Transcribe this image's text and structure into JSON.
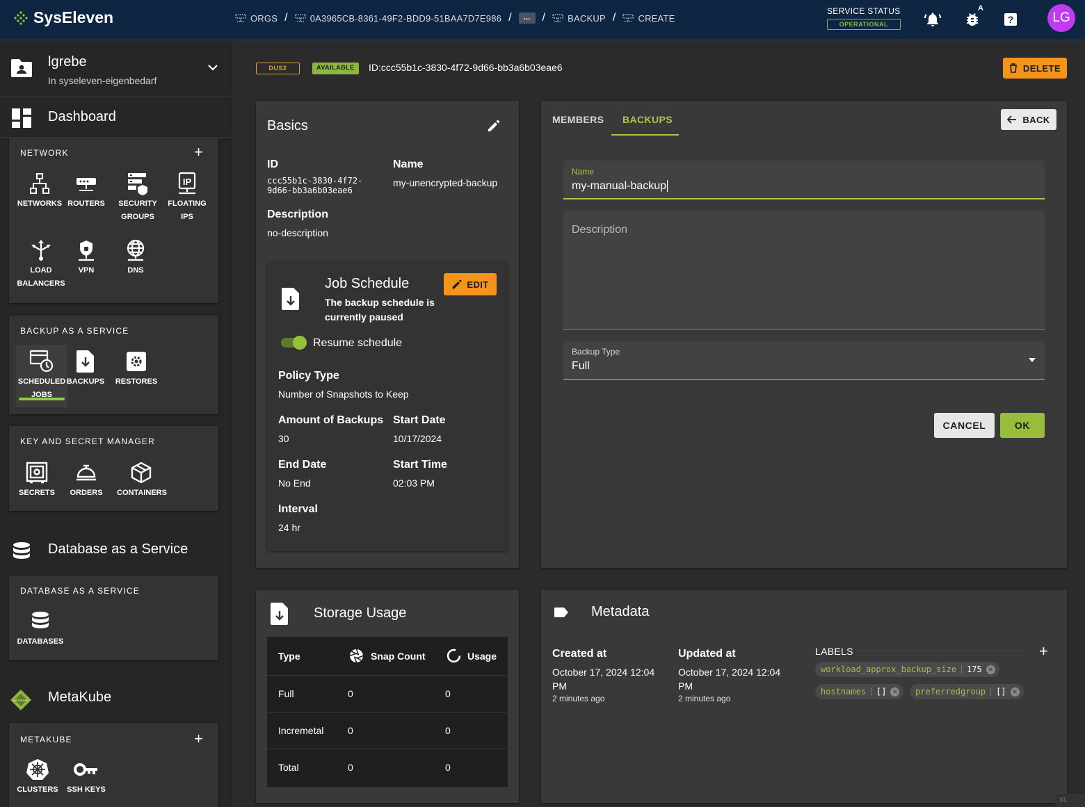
{
  "topbar": {
    "brand": "SysEleven",
    "breadcrumbs": [
      "ORGS",
      "0A3965CB-8361-49F2-BDD9-51BAA7D7E986",
      "...",
      "BACKUP",
      "CREATE"
    ],
    "service_status_label": "SERVICE STATUS",
    "service_status_value": "OPERATIONAL",
    "debug_badge": "A",
    "avatar_initials": "LG"
  },
  "sidebar": {
    "project_name": "lgrebe",
    "project_sub": "In syseleven-eigenbedarf",
    "dashboard_label": "Dashboard",
    "network": {
      "heading": "NETWORK",
      "items": [
        {
          "l1": "NETWORKS",
          "l2": ""
        },
        {
          "l1": "ROUTERS",
          "l2": ""
        },
        {
          "l1": "SECURITY",
          "l2": "GROUPS"
        },
        {
          "l1": "FLOATING",
          "l2": "IPS"
        },
        {
          "l1": "LOAD",
          "l2": "BALANCERS"
        },
        {
          "l1": "VPN",
          "l2": ""
        },
        {
          "l1": "DNS",
          "l2": ""
        }
      ]
    },
    "backup": {
      "heading": "BACKUP AS A SERVICE",
      "items": [
        {
          "l1": "SCHEDULED",
          "l2": "JOBS"
        },
        {
          "l1": "BACKUPS",
          "l2": ""
        },
        {
          "l1": "RESTORES",
          "l2": ""
        }
      ]
    },
    "keys": {
      "heading": "KEY AND SECRET MANAGER",
      "items": [
        {
          "l1": "SECRETS"
        },
        {
          "l1": "ORDERS"
        },
        {
          "l1": "CONTAINERS"
        }
      ]
    },
    "dbaas_title": "Database as a Service",
    "dbaas": {
      "heading": "DATABASE AS A SERVICE",
      "item": "DATABASES"
    },
    "metakube_title": "MetaKube",
    "metakube": {
      "heading": "METAKUBE",
      "items": [
        "CLUSTERS",
        "SSH KEYS"
      ]
    }
  },
  "header": {
    "region": "DUS2",
    "state": "AVAILABLE",
    "id_text": "ID:ccc55b1c-3830-4f72-9d66-bb3a6b03eae6",
    "delete_label": "DELETE"
  },
  "basics": {
    "title": "Basics",
    "id_label": "ID",
    "id_line1": "ccc55b1c-3830-4f72-",
    "id_line2": "9d66-bb3a6b03eae6",
    "name_label": "Name",
    "name_value": "my-unencrypted-backup",
    "desc_label": "Description",
    "desc_value": "no-description"
  },
  "job": {
    "title": "Job Schedule",
    "subtitle_1": "The backup schedule is",
    "subtitle_2": "currently paused",
    "edit_label": "EDIT",
    "toggle_label": "Resume schedule",
    "toggle_on": true,
    "policy_label": "Policy Type",
    "policy_value": "Number of Snapshots to Keep",
    "amount_label": "Amount of Backups",
    "amount_value": "30",
    "start_date_label": "Start Date",
    "start_date_value": "10/17/2024",
    "end_date_label": "End Date",
    "end_date_value": "No End",
    "start_time_label": "Start Time",
    "start_time_value": "02:03 PM",
    "interval_label": "Interval",
    "interval_value": "24 hr"
  },
  "panel": {
    "tabs": [
      "MEMBERS",
      "BACKUPS"
    ],
    "active_tab": "BACKUPS",
    "back_label": "BACK",
    "name_label": "Name",
    "name_value": "my-manual-backup",
    "description_placeholder": "Description",
    "backup_type_label": "Backup Type",
    "backup_type_value": "Full",
    "cancel_label": "CANCEL",
    "ok_label": "OK"
  },
  "storage": {
    "title": "Storage Usage",
    "columns": [
      "Type",
      "Snap Count",
      "Usage"
    ],
    "rows": [
      {
        "type": "Full",
        "count": "0",
        "usage": "0"
      },
      {
        "type": "Incremetal",
        "count": "0",
        "usage": "0"
      },
      {
        "type": "Total",
        "count": "0",
        "usage": "0"
      }
    ]
  },
  "metadata": {
    "title": "Metadata",
    "created_label": "Created at",
    "created_line1": "October 17, 2024 12:04",
    "created_line2": "PM",
    "created_ago": "2 minutes ago",
    "updated_label": "Updated at",
    "updated_line1": "October 17, 2024 12:04",
    "updated_line2": "PM",
    "updated_ago": "2 minutes ago",
    "labels_heading": "LABELS",
    "labels": [
      {
        "key": "workload_approx_backup_size",
        "value": "175"
      },
      {
        "key": "hostnames",
        "value": "[]"
      },
      {
        "key": "preferredgroup",
        "value": "[]"
      }
    ]
  },
  "corner_tag": "XL"
}
